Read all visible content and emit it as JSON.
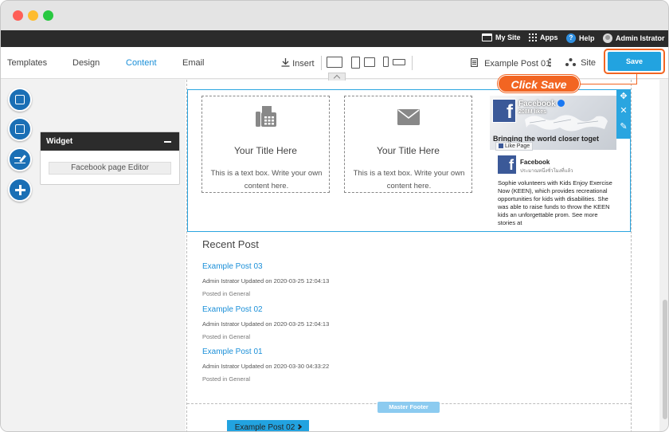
{
  "topbar": {
    "my_site": "My Site",
    "apps": "Apps",
    "help": "Help",
    "help_glyph": "?",
    "user": "Admin Istrator"
  },
  "menu": {
    "templates": "Templates",
    "design": "Design",
    "content": "Content",
    "email": "Email",
    "insert": "Insert",
    "page_name": "Example Post 01",
    "site": "Site",
    "save": "Save"
  },
  "annotation": {
    "callout": "Click Save",
    "color": "#f26522"
  },
  "widget": {
    "title": "Widget",
    "button": "Facebook page Editor"
  },
  "textboxes": [
    {
      "title": "Your Title Here",
      "body": "This is a text box. Write your own content here.",
      "icon": "fax-icon"
    },
    {
      "title": "Your Title Here",
      "body": "This is a text box. Write your own content here.",
      "icon": "mail-icon"
    }
  ],
  "facebook": {
    "page_name": "Facebook",
    "likes": "208M likes",
    "tagline": "Bringing the world closer toget",
    "like_button": "Like Page",
    "post_author": "Facebook",
    "post_sub": "ประมาณหนึ่งชั่วโมงที่แล้ว",
    "post_text": "Sophie volunteers with Kids Enjoy Exercise Now (KEEN), which provides recreational opportunities for kids with disabilities. She was able to raise funds to throw the KEEN kids an unforgettable prom. See more stories at"
  },
  "recent": {
    "title": "Recent Post",
    "posts": [
      {
        "title": "Example Post 03",
        "meta": "Admin Istrator Updated on 2020-03-25 12:04:13",
        "category": "Posted in General"
      },
      {
        "title": "Example Post 02",
        "meta": "Admin Istrator Updated on 2020-03-25 12:04:13",
        "category": "Posted in General"
      },
      {
        "title": "Example Post 01",
        "meta": "Admin Istrator Updated on 2020-03-30 04:33:22",
        "category": "Posted in General"
      }
    ]
  },
  "footer": {
    "tag": "Master Footer",
    "button": "Example Post 02"
  },
  "colors": {
    "accent": "#22a3e0",
    "topbar": "#2b2b2b",
    "facebook": "#3b5998"
  }
}
